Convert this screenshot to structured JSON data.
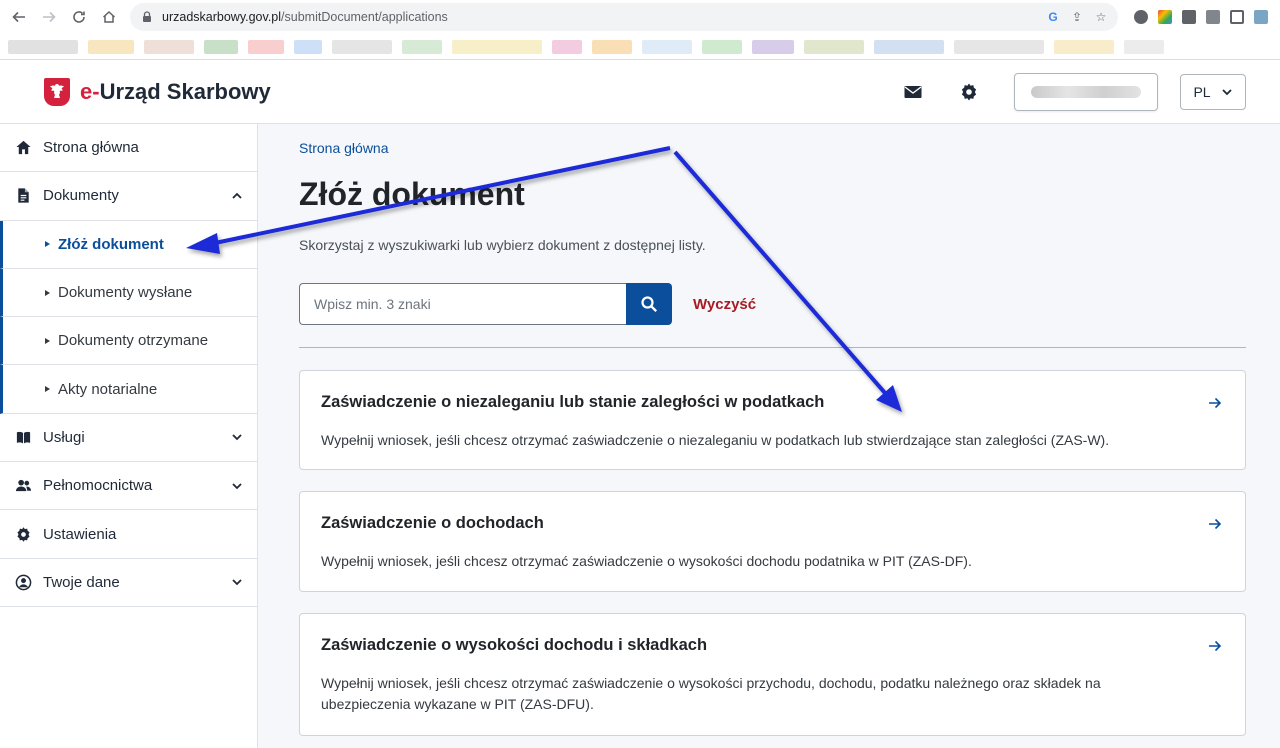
{
  "browser": {
    "url_domain": "urzadskarbowy.gov.pl",
    "url_path": "/submitDocument/applications"
  },
  "header": {
    "brand_prefix": "e-",
    "brand_name": "Urząd Skarbowy",
    "language": "PL"
  },
  "sidebar": {
    "items": [
      {
        "label": "Strona główna",
        "icon": "home-icon"
      },
      {
        "label": "Dokumenty",
        "icon": "document-icon"
      },
      {
        "label": "Usługi",
        "icon": "book-icon"
      },
      {
        "label": "Pełnomocnictwa",
        "icon": "users-icon"
      },
      {
        "label": "Ustawienia",
        "icon": "gear-icon"
      },
      {
        "label": "Twoje dane",
        "icon": "user-circle-icon"
      }
    ],
    "sub_items": [
      {
        "label": "Złóż dokument",
        "active": true
      },
      {
        "label": "Dokumenty wysłane",
        "active": false
      },
      {
        "label": "Dokumenty otrzymane",
        "active": false
      },
      {
        "label": "Akty notarialne",
        "active": false
      }
    ]
  },
  "main": {
    "breadcrumb": "Strona główna",
    "title": "Złóż dokument",
    "subtitle": "Skorzystaj z wyszukiwarki lub wybierz dokument z dostępnej listy.",
    "search_placeholder": "Wpisz min. 3 znaki",
    "clear_label": "Wyczyść",
    "cards": [
      {
        "title": "Zaświadczenie o niezaleganiu lub stanie zaległości w podatkach",
        "description": "Wypełnij wniosek, jeśli chcesz otrzymać zaświadczenie o niezaleganiu w podatkach lub stwierdzające stan zaległości (ZAS-W)."
      },
      {
        "title": "Zaświadczenie o dochodach",
        "description": "Wypełnij wniosek, jeśli chcesz otrzymać zaświadczenie o wysokości dochodu podatnika w PIT (ZAS-DF)."
      },
      {
        "title": "Zaświadczenie o wysokości dochodu i składkach",
        "description": "Wypełnij wniosek, jeśli chcesz otrzymać zaświadczenie o wysokości przychodu, dochodu, podatku należnego oraz składek na ubezpieczenia wykazane w PIT (ZAS-DFU)."
      }
    ]
  },
  "colors": {
    "primary": "#0b4f9c",
    "brand_red": "#d4213d",
    "clear_red": "#a61b24",
    "annotation_arrow": "#1f2bd8"
  }
}
